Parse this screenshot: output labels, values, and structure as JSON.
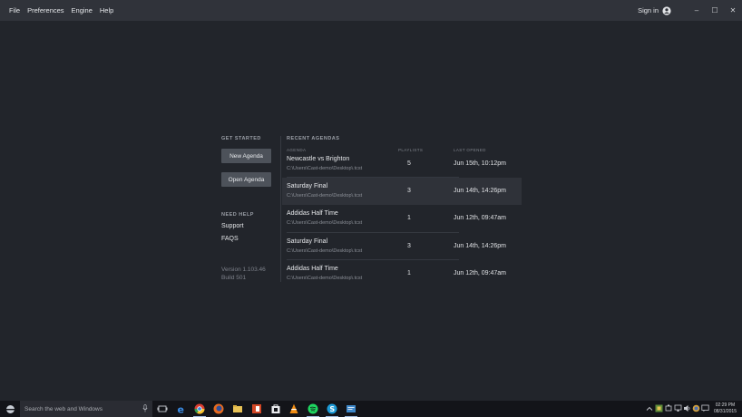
{
  "menubar": {
    "items": [
      "File",
      "Preferences",
      "Engine",
      "Help"
    ],
    "sign_in_label": "Sign in"
  },
  "window_controls": {
    "minimize": "–",
    "maximize": "☐",
    "close": "✕"
  },
  "get_started": {
    "heading": "GET STARTED",
    "new_agenda_label": "New Agenda",
    "open_agenda_label": "Open Agenda"
  },
  "need_help": {
    "heading": "NEED HELP",
    "support_label": "Support",
    "faqs_label": "FAQS"
  },
  "version_info": {
    "version": "Version 1.103.46",
    "build": "Build 501"
  },
  "recent": {
    "heading": "RECENT AGENDAS",
    "columns": {
      "agenda": "AGENDA",
      "playlists": "PLAYLISTS",
      "last_opened": "LAST OPENED"
    },
    "rows": [
      {
        "name": "Newcastle vs Brighton",
        "path": "C:\\Users\\Cast-demo\\Desktop\\.tcst",
        "playlists": "5",
        "last_opened": "Jun 15th, 10:12pm",
        "selected": false
      },
      {
        "name": "Saturday Final",
        "path": "C:\\Users\\Cast-demo\\Desktop\\.tcst",
        "playlists": "3",
        "last_opened": "Jun 14th, 14:26pm",
        "selected": true
      },
      {
        "name": "Addidas Half Time",
        "path": "C:\\Users\\Cast-demo\\Desktop\\.tcst",
        "playlists": "1",
        "last_opened": "Jun 12th, 09:47am",
        "selected": false
      },
      {
        "name": "Saturday Final",
        "path": "C:\\Users\\Cast-demo\\Desktop\\.tcst",
        "playlists": "3",
        "last_opened": "Jun 14th, 14:26pm",
        "selected": false
      },
      {
        "name": "Addidas Half Time",
        "path": "C:\\Users\\Cast-demo\\Desktop\\.tcst",
        "playlists": "1",
        "last_opened": "Jun 12th, 09:47am",
        "selected": false
      }
    ]
  },
  "taskbar": {
    "search_placeholder": "Search the web and Windows",
    "apps": [
      "task-view-icon",
      "edge-icon",
      "chrome-icon",
      "firefox-icon",
      "file-explorer-icon",
      "office-icon",
      "store-icon",
      "vlc-icon",
      "spotify-icon",
      "skype-icon",
      "app-window-icon"
    ],
    "clock_time": "02:29 PM",
    "clock_date": "08/31/2015"
  },
  "colors": {
    "background": "#22252b",
    "titlebar": "#30333a",
    "button": "#4d525a",
    "selected_row": "#2f3239",
    "taskbar": "#131419"
  }
}
